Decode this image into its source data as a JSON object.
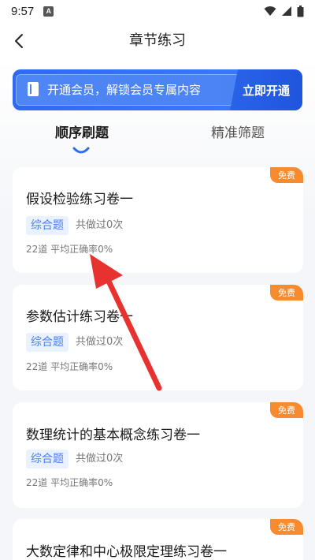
{
  "status_bar": {
    "time": "9:57",
    "notification_letter": "A",
    "icons": [
      "wifi-icon",
      "signal-icon",
      "battery-icon"
    ]
  },
  "header": {
    "title": "章节练习",
    "back_icon": "chevron-left-icon"
  },
  "vip_banner": {
    "icon": "book-icon",
    "text": "开通会员，解锁会员专属内容",
    "button_label": "立即开通"
  },
  "tabs": [
    {
      "label": "顺序刷题",
      "active": true
    },
    {
      "label": "精准筛题",
      "active": false
    }
  ],
  "cards": [
    {
      "title": "假设检验练习卷一",
      "badge": "免费",
      "tag": "综合题",
      "done": "共做过0次",
      "stats": "22道 平均正确率0%"
    },
    {
      "title": "参数估计练习卷一",
      "badge": "免费",
      "tag": "综合题",
      "done": "共做过0次",
      "stats": "22道 平均正确率0%"
    },
    {
      "title": "数理统计的基本概念练习卷一",
      "badge": "免费",
      "tag": "综合题",
      "done": "共做过0次",
      "stats": "22道 平均正确率0%"
    },
    {
      "title": "大数定律和中心极限定理练习卷一",
      "badge": "免费"
    }
  ],
  "colors": {
    "accent_blue": "#3c7bff",
    "tag_text": "#4a80f0",
    "badge_orange": "#f88b2e",
    "annotation_red": "#e8322f"
  }
}
